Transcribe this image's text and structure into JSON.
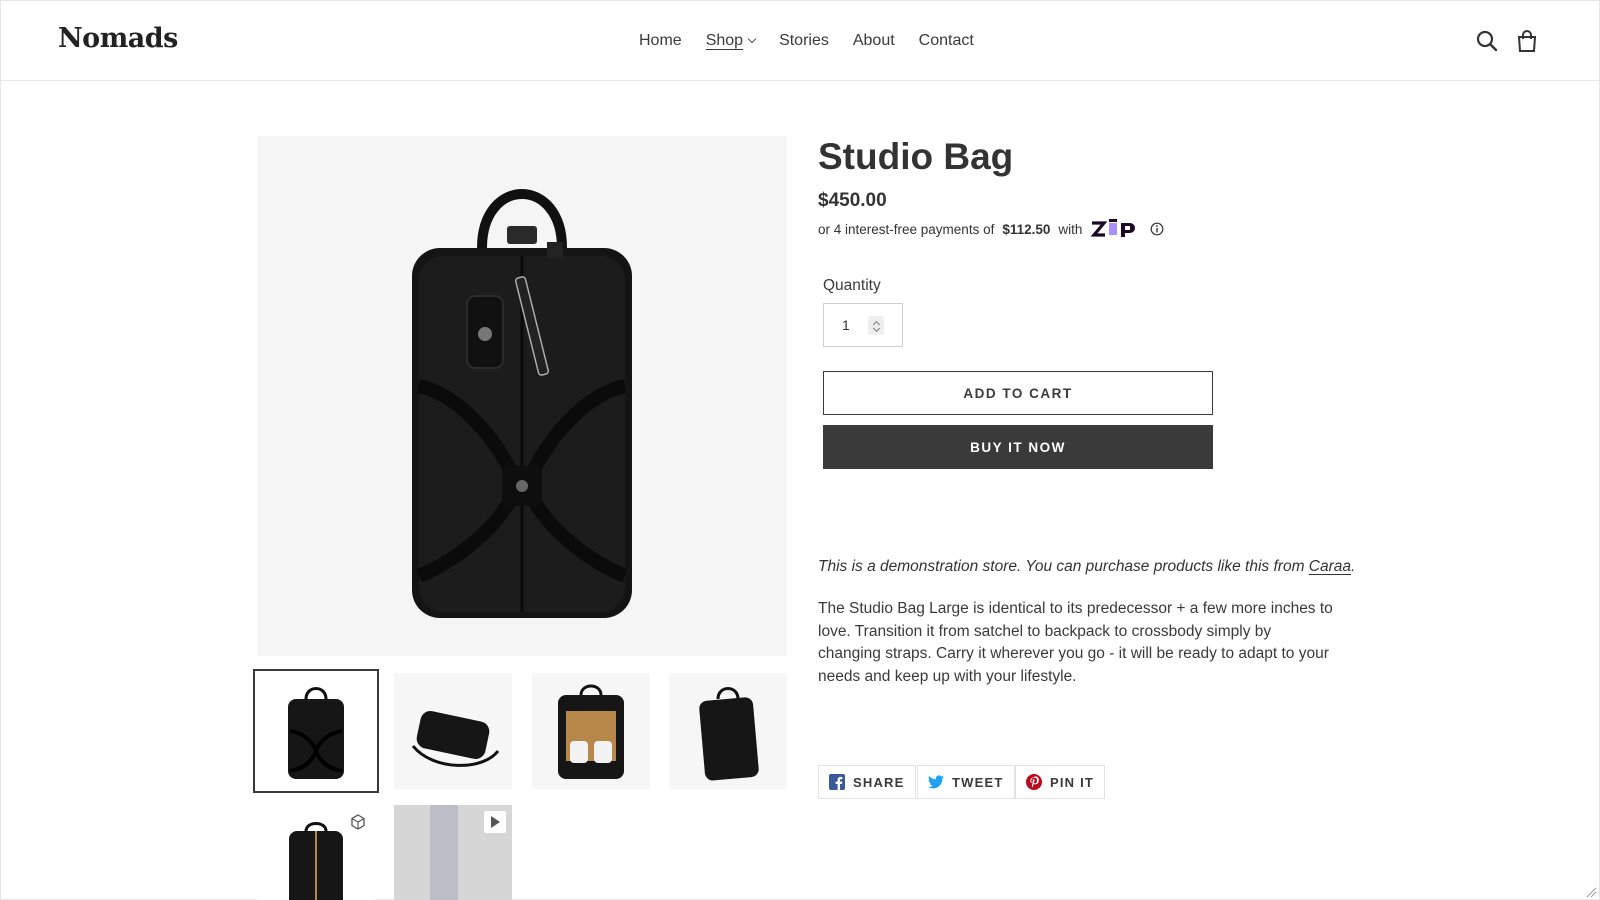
{
  "header": {
    "logo": "Nomads",
    "nav": [
      {
        "label": "Home"
      },
      {
        "label": "Shop"
      },
      {
        "label": "Stories"
      },
      {
        "label": "About"
      },
      {
        "label": "Contact"
      }
    ],
    "icons": [
      "search-icon",
      "cart-icon"
    ]
  },
  "product": {
    "title": "Studio Bag",
    "price": "$450.00",
    "installments": {
      "prefix": "or 4 interest-free payments of",
      "amount": "$112.50",
      "suffix": "with",
      "provider": "zip"
    },
    "quantity_label": "Quantity",
    "quantity_value": "1",
    "add_to_cart": "ADD TO CART",
    "buy_now": "BUY IT NOW",
    "demo_note": "This is a demonstration store. You can purchase products like this from",
    "demo_link": "Caraa",
    "demo_end": ".",
    "description": "The Studio Bag Large is identical to its predecessor + a few more inches to love. Transition it from satchel to backpack to crossbody simply by changing straps. Carry it wherever you go - it will be ready to adapt to your needs and keep up with your lifestyle."
  },
  "share": [
    {
      "label": "SHARE",
      "icon": "facebook-icon",
      "color": "#3b5998"
    },
    {
      "label": "TWEET",
      "icon": "twitter-icon",
      "color": "#1da1f2"
    },
    {
      "label": "PIN IT",
      "icon": "pinterest-icon",
      "color": "#bd081c"
    }
  ],
  "gallery": {
    "thumbnails": [
      "front",
      "side",
      "open",
      "angle",
      "3d-model",
      "video"
    ],
    "selected": 0
  },
  "colors": {
    "text": "#3a3a3a",
    "button_dark": "#3a3a3a",
    "zip_purple": "#aa8fff"
  }
}
